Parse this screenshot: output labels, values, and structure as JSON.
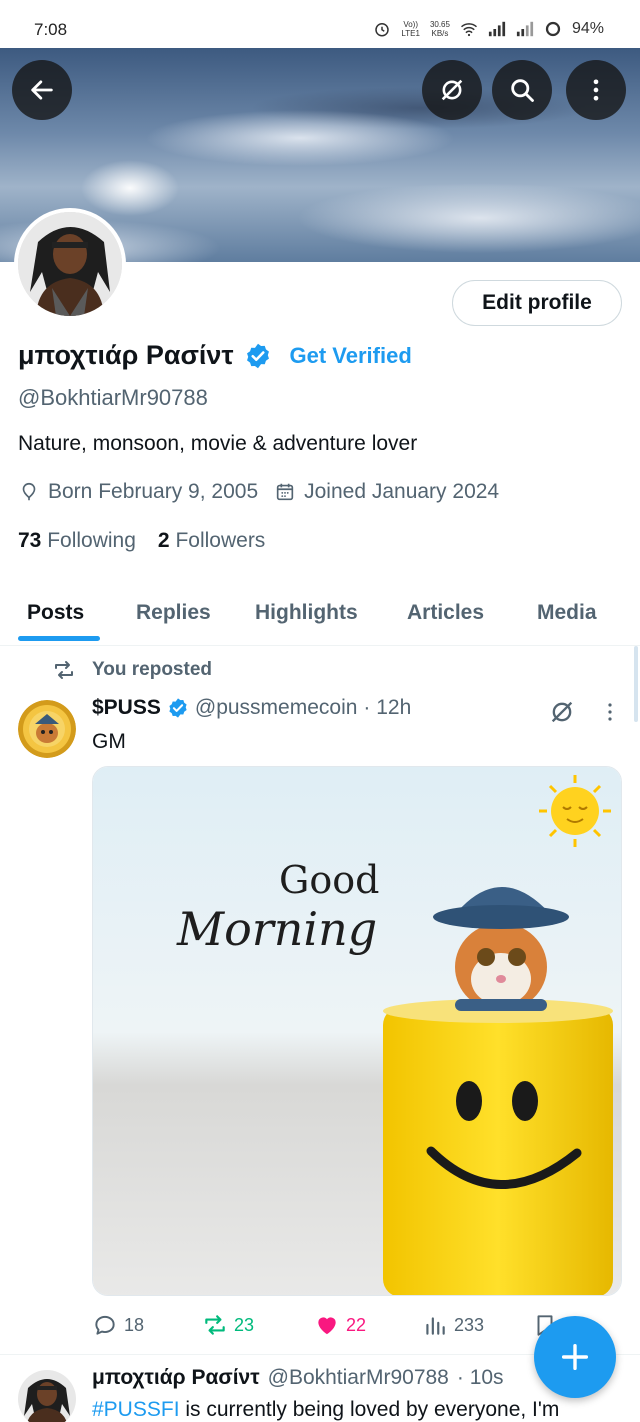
{
  "status_bar": {
    "time": "7:08",
    "volte": "Vo))",
    "lte": "LTE1",
    "speed_value": "30.65",
    "speed_unit": "KB/s",
    "battery": "94%"
  },
  "header": {
    "back_icon": "arrow-left-icon",
    "grok_icon": "grok-icon",
    "search_icon": "search-icon",
    "more_icon": "more-vertical-icon"
  },
  "profile": {
    "display_name": "μποχτιάρ Ρασίντ",
    "get_verified": "Get Verified",
    "handle": "@BokhtiarMr90788",
    "bio": "Nature, monsoon, movie & adventure lover",
    "born": "Born February 9, 2005",
    "joined": "Joined January 2024",
    "following_count": "73",
    "following_label": "Following",
    "followers_count": "2",
    "followers_label": "Followers",
    "edit_profile": "Edit profile"
  },
  "tabs": [
    {
      "label": "Posts",
      "active": true
    },
    {
      "label": "Replies",
      "active": false
    },
    {
      "label": "Highlights",
      "active": false
    },
    {
      "label": "Articles",
      "active": false
    },
    {
      "label": "Media",
      "active": false
    }
  ],
  "post1": {
    "repost_label": "You reposted",
    "name": "$PUSS",
    "handle": "@pussmemecoin",
    "time": "· 12h",
    "text": "GM",
    "image": {
      "good": "Good",
      "morning": "Morning"
    },
    "replies": "18",
    "reposts": "23",
    "likes": "22",
    "views": "233"
  },
  "post2": {
    "name": "μποχτιάρ Ρασίντ",
    "handle": "@BokhtiarMr90788",
    "time": "· 10s",
    "hashtag": "#PUSSFI",
    "text": " is currently being loved by everyone, I'm"
  },
  "colors": {
    "accent": "#1d9bf0",
    "repost_green": "#00ba7c",
    "like_pink": "#f91880",
    "secondary_text": "#536471"
  }
}
